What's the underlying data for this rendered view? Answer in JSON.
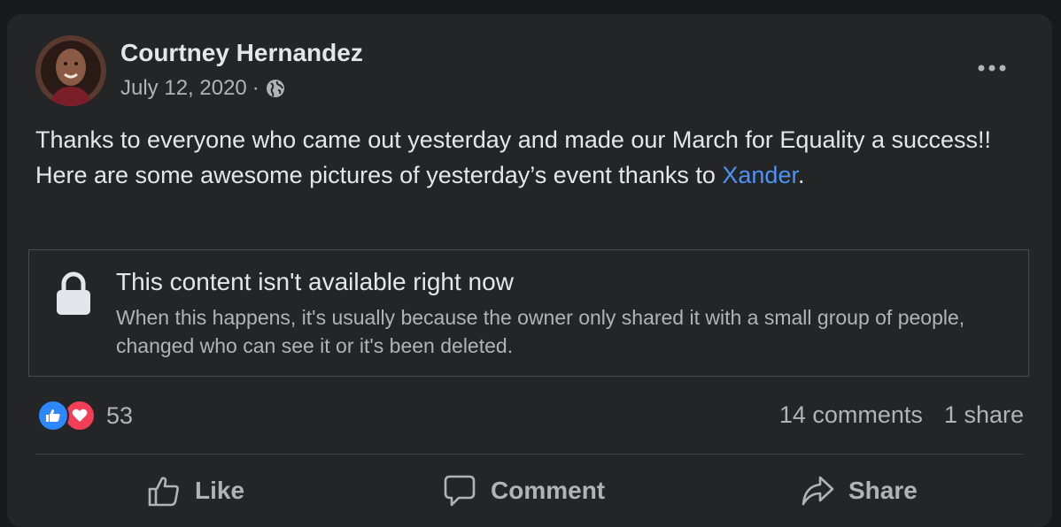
{
  "post": {
    "author": "Courtney Hernandez",
    "date": "July 12, 2020",
    "separator": "·",
    "privacy_icon": "globe-icon",
    "more_icon": "more-options-icon",
    "text_main": "Thanks to everyone who came out yesterday and made our March for Equality a success!! Here are some awesome pictures of yesterday’s event thanks to ",
    "mention": "Xander",
    "text_end": "."
  },
  "unavailable": {
    "title": "This content isn't available right now",
    "description": "When this happens, it's usually because the owner only shared it with a small group of people, changed who can see it or it's been deleted.",
    "icon": "lock-icon"
  },
  "stats": {
    "reaction_count": "53",
    "comments": "14 comments",
    "shares": "1 share",
    "reaction_icons": [
      "like-icon",
      "love-icon"
    ]
  },
  "actions": {
    "like": "Like",
    "comment": "Comment",
    "share": "Share"
  },
  "colors": {
    "background": "#18191a",
    "card": "#242526",
    "primary_text": "#e4e6eb",
    "secondary_text": "#b0b3b8",
    "link": "#4b93f5",
    "like_blue": "#2d88ff",
    "love_red": "#f33e58"
  }
}
